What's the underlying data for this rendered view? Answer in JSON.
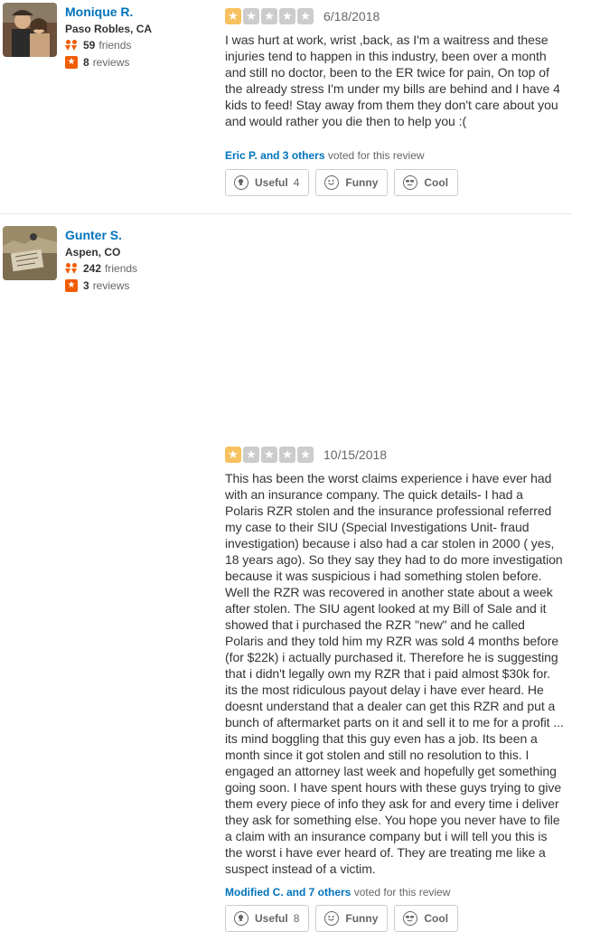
{
  "reviews": [
    {
      "user": {
        "name": "Monique R.",
        "location": "Paso Robles, CA",
        "friends_count": "59",
        "friends_label": "friends",
        "reviews_count": "8",
        "reviews_label": "reviews"
      },
      "rating": 1,
      "rating_max": 5,
      "date": "6/18/2018",
      "text": "I was hurt at work, wrist ,back, as I'm a waitress and these injuries tend to happen in this industry, been over a month and still no doctor,  been to the ER twice for pain, On top of the already stress I'm under my bills are behind and I have 4 kids to feed! Stay away from them they don't care about you and would rather you die then to help you :(",
      "voters": "Eric P. and 3 others",
      "voted_suffix": "voted for this review",
      "buttons": {
        "useful": "Useful",
        "useful_count": "4",
        "funny": "Funny",
        "cool": "Cool"
      }
    },
    {
      "user": {
        "name": "Gunter S.",
        "location": "Aspen, CO",
        "friends_count": "242",
        "friends_label": "friends",
        "reviews_count": "3",
        "reviews_label": "reviews"
      },
      "rating": 1,
      "rating_max": 5,
      "date": "10/15/2018",
      "text": "This has been the worst claims experience i have ever had with an insurance company. The quick details- I had a Polaris RZR stolen and the insurance professional referred my case to their SIU (Special Investigations Unit- fraud investigation) because i also had a car stolen in 2000 ( yes, 18 years ago). So they say they had to do more investigation because it was suspicious i had something stolen before. Well the RZR was recovered in another state about a week after stolen. The SIU agent looked at my Bill of Sale and it showed that i purchased the RZR \"new\" and he called Polaris and they told him my RZR was sold 4 months before (for $22k) i actually purchased it. Therefore he is suggesting that i didn't legally own my RZR that i paid almost $30k for. its the most ridiculous payout delay i have ever heard. He doesnt understand that a dealer can get this RZR and put a bunch of aftermarket parts on it and sell it to me for a profit ... its mind boggling that this guy even has a job. Its been a month since it got stolen and still no resolution to this. I engaged an attorney last week and hopefully get something going soon. I have spent hours with these guys trying to give them every piece of info they ask for and every time i deliver they ask for something else. You hope you never have to file a claim with an insurance company but i will tell you this is the worst i have ever heard of. They are treating me like a suspect instead of a victim.",
      "voters": "Modified C. and 7 others",
      "voted_suffix": "voted for this review",
      "buttons": {
        "useful": "Useful",
        "useful_count": "8",
        "funny": "Funny",
        "cool": "Cool"
      }
    }
  ],
  "icons": {
    "friends": "friends-icon",
    "reviews": "star-icon",
    "useful": "lightbulb-icon",
    "funny": "smiley-icon",
    "cool": "sunglasses-icon",
    "rating": "star-icon"
  },
  "colors": {
    "user_link": "#0073bb",
    "star_filled": "#f8c15f",
    "star_empty": "#cccccc",
    "accent": "#f15c00"
  }
}
